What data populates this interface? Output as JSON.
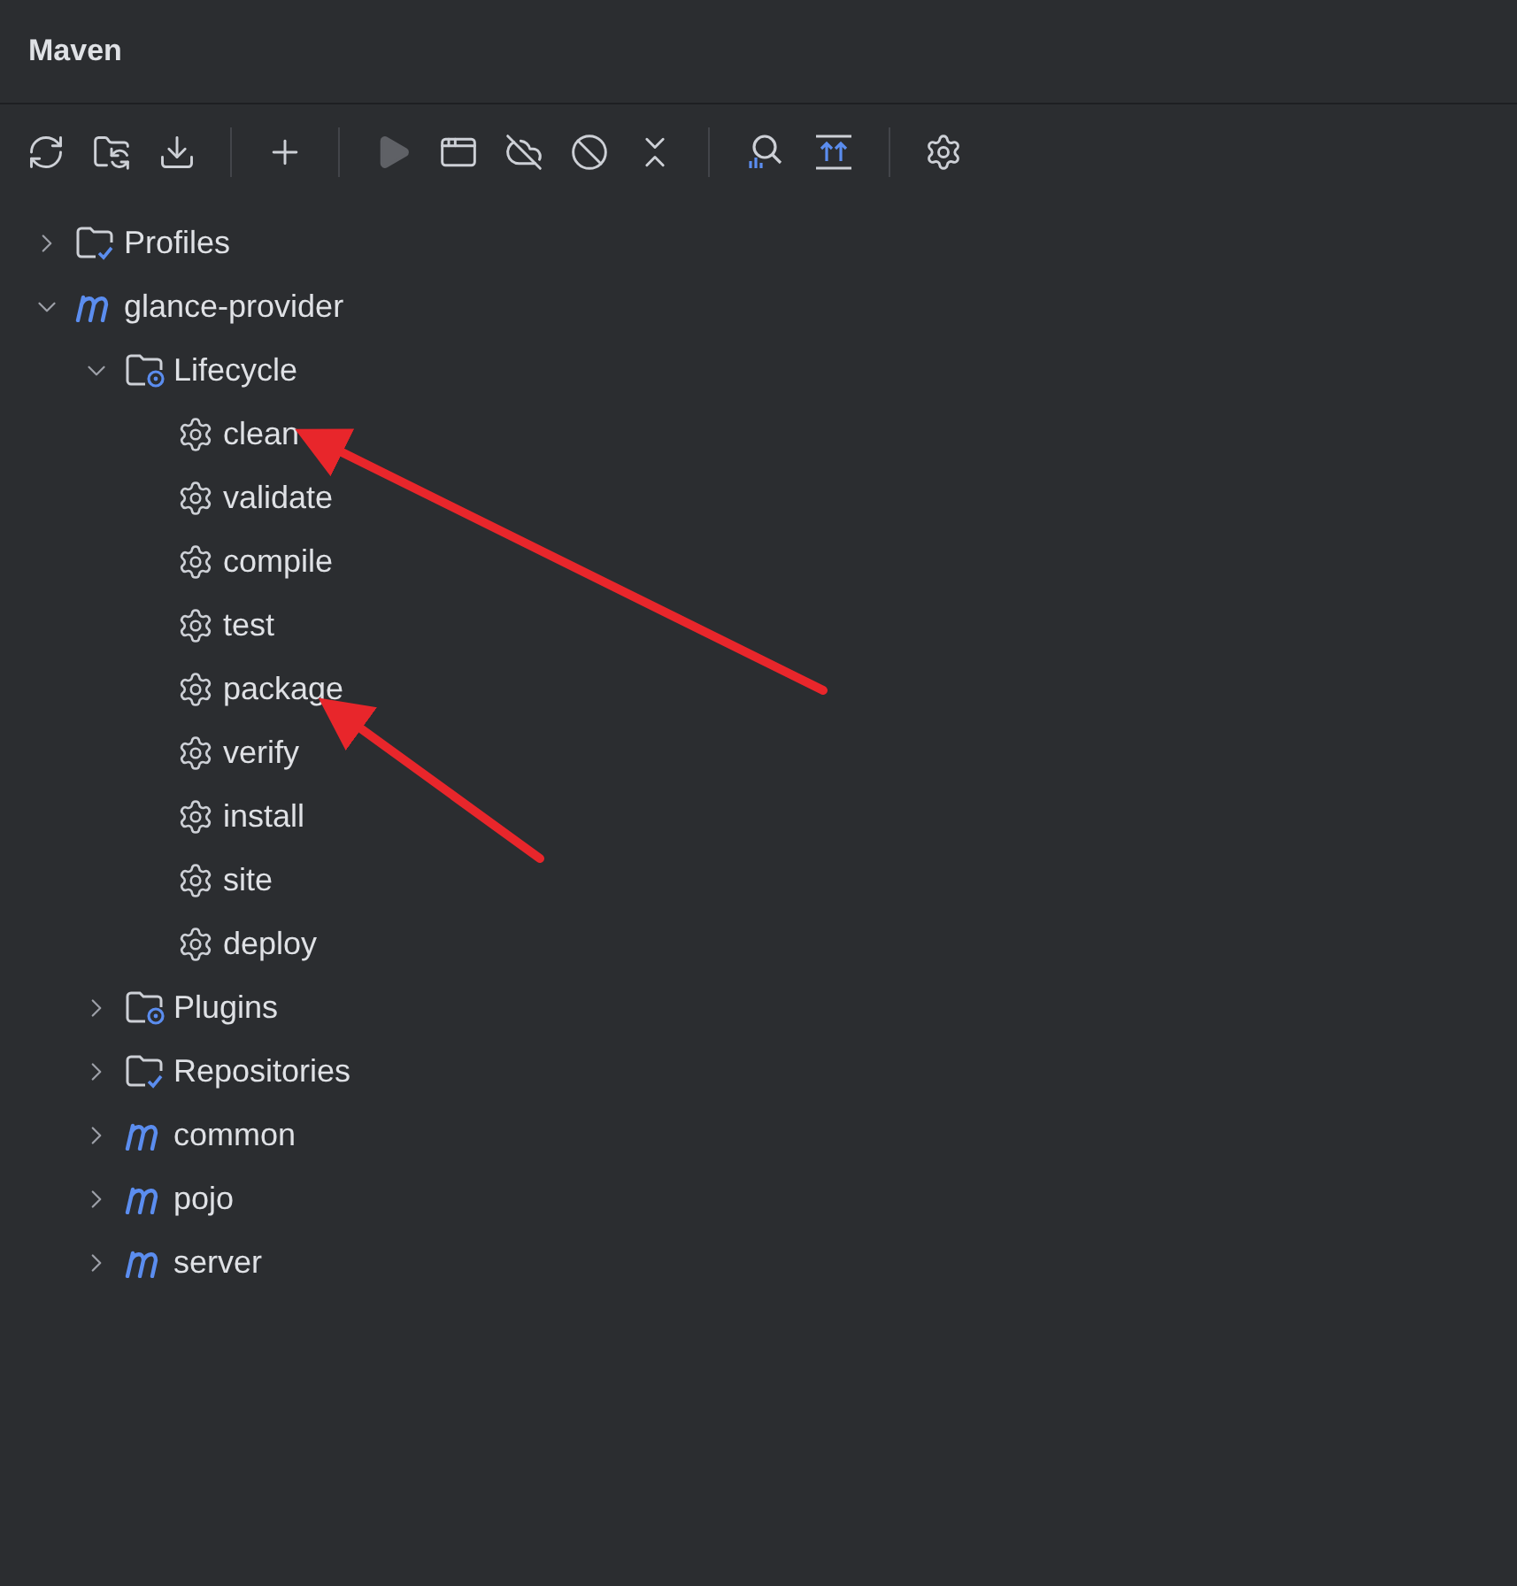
{
  "title": "Maven",
  "toolbar": [
    {
      "kind": "reload",
      "disabled": false
    },
    {
      "kind": "folder-sync",
      "disabled": false
    },
    {
      "kind": "download",
      "disabled": false
    },
    {
      "kind": "separator"
    },
    {
      "kind": "add",
      "disabled": false
    },
    {
      "kind": "separator"
    },
    {
      "kind": "run",
      "disabled": true
    },
    {
      "kind": "window",
      "disabled": false
    },
    {
      "kind": "offline",
      "disabled": false
    },
    {
      "kind": "skip",
      "disabled": false
    },
    {
      "kind": "collapse",
      "disabled": false
    },
    {
      "kind": "separator"
    },
    {
      "kind": "analyze",
      "disabled": false
    },
    {
      "kind": "show-updates",
      "disabled": false
    },
    {
      "kind": "separator"
    },
    {
      "kind": "settings",
      "disabled": false
    }
  ],
  "tree": [
    {
      "kind": "profiles",
      "label": "Profiles",
      "expanded": false
    },
    {
      "kind": "module",
      "label": "glance-provider",
      "expanded": true,
      "children": [
        {
          "kind": "lifecycle",
          "label": "Lifecycle",
          "expanded": true,
          "children": [
            {
              "kind": "goal",
              "label": "clean"
            },
            {
              "kind": "goal",
              "label": "validate"
            },
            {
              "kind": "goal",
              "label": "compile"
            },
            {
              "kind": "goal",
              "label": "test"
            },
            {
              "kind": "goal",
              "label": "package"
            },
            {
              "kind": "goal",
              "label": "verify"
            },
            {
              "kind": "goal",
              "label": "install"
            },
            {
              "kind": "goal",
              "label": "site"
            },
            {
              "kind": "goal",
              "label": "deploy"
            }
          ]
        },
        {
          "kind": "plugins",
          "label": "Plugins",
          "expanded": false
        },
        {
          "kind": "repositories",
          "label": "Repositories",
          "expanded": false
        },
        {
          "kind": "module",
          "label": "common",
          "expanded": false
        },
        {
          "kind": "module",
          "label": "pojo",
          "expanded": false
        },
        {
          "kind": "module",
          "label": "server",
          "expanded": false
        }
      ]
    }
  ],
  "annotations": [
    {
      "kind": "arrow"
    },
    {
      "kind": "arrow"
    }
  ]
}
